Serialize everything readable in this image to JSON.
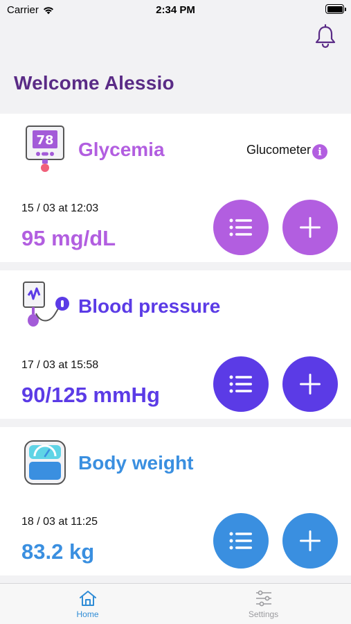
{
  "status_bar": {
    "carrier": "Carrier",
    "time": "2:34 PM"
  },
  "header": {
    "welcome": "Welcome Alessio",
    "bell_icon": "bell-icon"
  },
  "cards": [
    {
      "title": "Glycemia",
      "device": "Glucometer",
      "date": "15 / 03 at 12:03",
      "value": "95 mg/dL",
      "color": "#b25ee0",
      "icon": "glucometer-icon"
    },
    {
      "title": "Blood pressure",
      "date": "17 / 03 at 15:58",
      "value": "90/125 mmHg",
      "color": "#5b3be6",
      "icon": "blood-pressure-monitor-icon"
    },
    {
      "title": "Body weight",
      "date": "18 / 03 at 11:25",
      "value": "83.2 kg",
      "color": "#3a8fe0",
      "icon": "scale-icon"
    }
  ],
  "tabs": [
    {
      "label": "Home",
      "icon": "home-icon",
      "active": true,
      "color": "#2f8cd6"
    },
    {
      "label": "Settings",
      "icon": "sliders-icon",
      "active": false,
      "color": "#9a9a9e"
    }
  ]
}
